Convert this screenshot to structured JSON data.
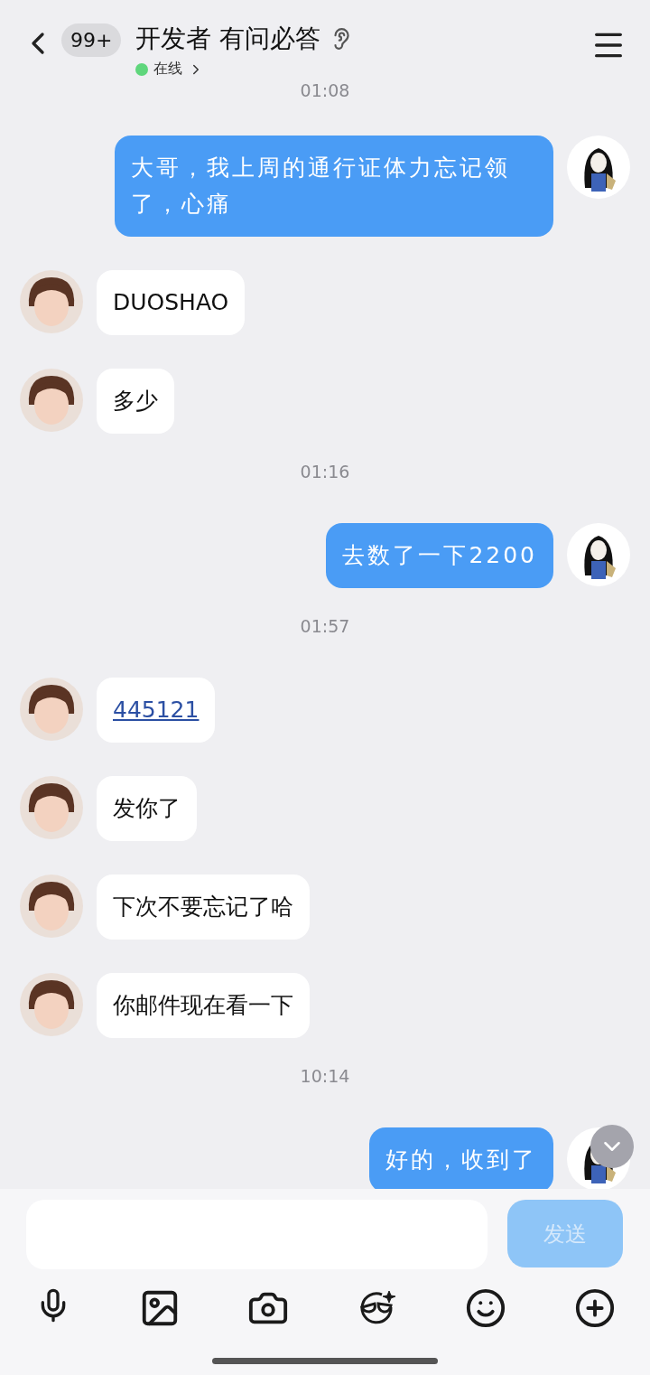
{
  "header": {
    "unread_badge": "99+",
    "title": "开发者 有问必答",
    "status": {
      "label": "在线",
      "online": true
    }
  },
  "messages": [
    {
      "kind": "time",
      "text": "01:08"
    },
    {
      "kind": "sent",
      "text": "大哥，我上周的通行证体力忘记领了，心痛",
      "link": false
    },
    {
      "kind": "received",
      "text": "DUOSHAO",
      "link": false
    },
    {
      "kind": "received",
      "text": "多少",
      "link": false
    },
    {
      "kind": "time",
      "text": "01:16"
    },
    {
      "kind": "sent",
      "text": "去数了一下2200",
      "link": false
    },
    {
      "kind": "time",
      "text": "01:57"
    },
    {
      "kind": "received",
      "text": "445121",
      "link": true
    },
    {
      "kind": "received",
      "text": "发你了",
      "link": false
    },
    {
      "kind": "received",
      "text": "下次不要忘记了哈",
      "link": false
    },
    {
      "kind": "received",
      "text": "你邮件现在看一下",
      "link": false
    },
    {
      "kind": "time",
      "text": "10:14"
    },
    {
      "kind": "sent",
      "text": "好的，收到了",
      "link": false
    }
  ],
  "composer": {
    "send_label": "发送",
    "send_enabled": false
  }
}
